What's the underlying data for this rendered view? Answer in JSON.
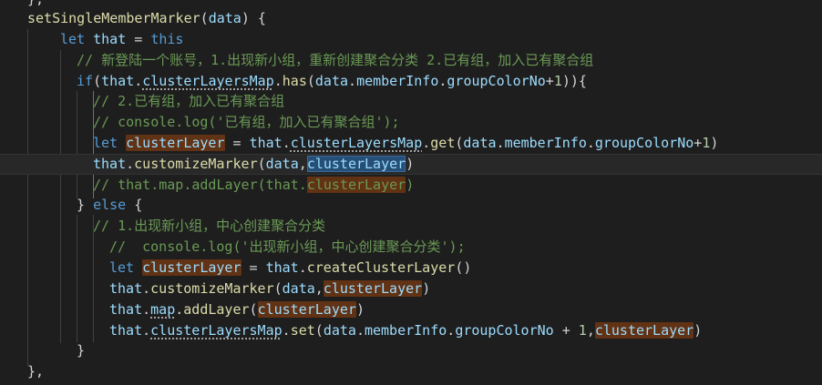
{
  "lines": [
    {
      "text": "},"
    },
    {
      "text": "setSingleMemberMarker(data) {"
    },
    {
      "text": "let that = this"
    },
    {
      "text": "// 新登陆一个账号，1.出现新小组，重新创建聚合分类 2.已有组，加入已有聚合组"
    },
    {
      "text": "if(that.clusterLayersMap.has(data.memberInfo.groupColorNo+1)){"
    },
    {
      "text": "// 2.已有组，加入已有聚合组"
    },
    {
      "text": "// console.log('已有组，加入已有聚合组');"
    },
    {
      "text": "let clusterLayer = that.clusterLayersMap.get(data.memberInfo.groupColorNo+1)"
    },
    {
      "text": "that.customizeMarker(data,clusterLayer)"
    },
    {
      "text": "// that.map.addLayer(that.clusterLayer)"
    },
    {
      "text": "} else {"
    },
    {
      "text": "// 1.出现新小组，中心创建聚合分类"
    },
    {
      "text": "//  console.log('出现新小组，中心创建聚合分类');"
    },
    {
      "text": "let clusterLayer = that.createClusterLayer()"
    },
    {
      "text": "that.customizeMarker(data,clusterLayer)"
    },
    {
      "text": "that.map.addLayer(clusterLayer)"
    },
    {
      "text": "that.clusterLayersMap.set(data.memberInfo.groupColorNo + 1,clusterLayer)"
    },
    {
      "text": "}"
    },
    {
      "text": "},"
    }
  ],
  "tokens": {
    "l0": {
      "t0": "},"
    },
    "l1": {
      "t0": "setSingleMemberMarker",
      "t1": "(",
      "t2": "data",
      "t3": ") {"
    },
    "l2": {
      "t0": "let",
      "t1": " ",
      "t2": "that",
      "t3": " = ",
      "t4": "this"
    },
    "l3": {
      "t0": "// 新登陆一个账号，1.出现新小组，重新创建聚合分类 2.已有组，加入已有聚合组"
    },
    "l4": {
      "t0": "if",
      "t1": "(",
      "t2": "that",
      "t3": ".",
      "t4": "clusterLayersMap",
      "t5": ".",
      "t6": "has",
      "t7": "(",
      "t8": "data",
      "t9": ".",
      "t10": "memberInfo",
      "t11": ".",
      "t12": "groupColorNo",
      "t13": "+",
      "t14": "1",
      "t15": ")){"
    },
    "l5": {
      "t0": "// 2.已有组，加入已有聚合组"
    },
    "l6": {
      "t0": "// console.log('已有组，加入已有聚合组');"
    },
    "l7": {
      "t0": "let",
      "t1": " ",
      "t2": "clusterLayer",
      "t3": " = ",
      "t4": "that",
      "t5": ".",
      "t6": "clusterLayersMap",
      "t7": ".",
      "t8": "get",
      "t9": "(",
      "t10": "data",
      "t11": ".",
      "t12": "memberInfo",
      "t13": ".",
      "t14": "groupColorNo",
      "t15": "+",
      "t16": "1",
      "t17": ")"
    },
    "l8": {
      "t0": "that",
      "t1": ".",
      "t2": "customizeMarker",
      "t3": "(",
      "t4": "data",
      "t5": ",",
      "t6": "clusterLayer",
      "t7": ")"
    },
    "l9": {
      "t0": "// that.map.addLayer(that.",
      "t1": "clusterLayer",
      "t2": ")"
    },
    "l10": {
      "t0": "} ",
      "t1": "else",
      "t2": " {"
    },
    "l11": {
      "t0": "// 1.出现新小组，中心创建聚合分类"
    },
    "l12": {
      "t0": "//  console.log('出现新小组，中心创建聚合分类');"
    },
    "l13": {
      "t0": "let",
      "t1": " ",
      "t2": "clusterLayer",
      "t3": " = ",
      "t4": "that",
      "t5": ".",
      "t6": "createClusterLayer",
      "t7": "()"
    },
    "l14": {
      "t0": "that",
      "t1": ".",
      "t2": "customizeMarker",
      "t3": "(",
      "t4": "data",
      "t5": ",",
      "t6": "clusterLayer",
      "t7": ")"
    },
    "l15": {
      "t0": "that",
      "t1": ".",
      "t2": "map",
      "t3": ".",
      "t4": "addLayer",
      "t5": "(",
      "t6": "clusterLayer",
      "t7": ")"
    },
    "l16": {
      "t0": "that",
      "t1": ".",
      "t2": "clusterLayersMap",
      "t3": ".",
      "t4": "set",
      "t5": "(",
      "t6": "data",
      "t7": ".",
      "t8": "memberInfo",
      "t9": ".",
      "t10": "groupColorNo",
      "t11": " + ",
      "t12": "1",
      "t13": ",",
      "t14": "clusterLayer",
      "t15": ")"
    },
    "l17": {
      "t0": "}"
    },
    "l18": {
      "t0": "},"
    }
  },
  "theme": {
    "background": "#1e1e1e",
    "keyword": "#569cd6",
    "function": "#dcdcaa",
    "variable": "#9cdcfe",
    "string": "#ce9178",
    "number": "#b5cea8",
    "comment": "#6a9955",
    "occurrence_highlight": "#613214",
    "selection": "#264f78",
    "current_line": "#282828"
  }
}
